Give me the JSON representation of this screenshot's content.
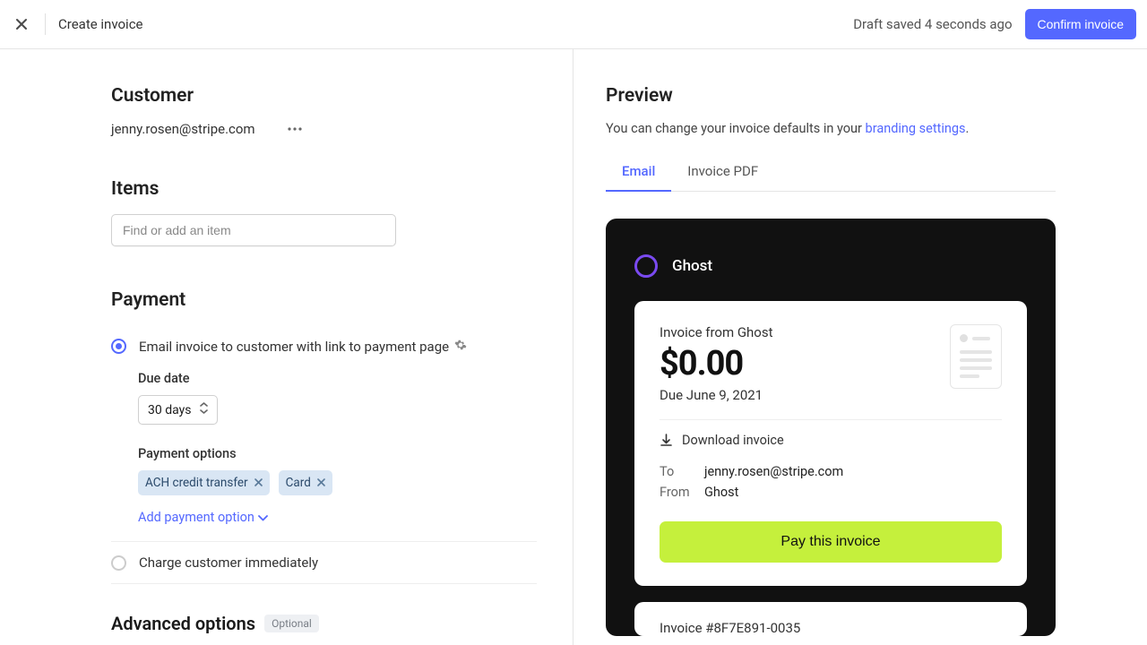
{
  "header": {
    "title": "Create invoice",
    "draft_status": "Draft saved 4 seconds ago",
    "confirm_label": "Confirm invoice"
  },
  "customer": {
    "heading": "Customer",
    "email": "jenny.rosen@stripe.com"
  },
  "items": {
    "heading": "Items",
    "placeholder": "Find or add an item"
  },
  "payment": {
    "heading": "Payment",
    "option_email": "Email invoice to customer with link to payment page",
    "option_charge": "Charge customer immediately",
    "due_date_label": "Due date",
    "due_date_value": "30 days",
    "options_label": "Payment options",
    "chips": [
      "ACH credit transfer",
      "Card"
    ],
    "add_option": "Add payment option"
  },
  "advanced": {
    "heading": "Advanced options",
    "badge": "Optional"
  },
  "preview": {
    "heading": "Preview",
    "desc_prefix": "You can change your invoice defaults in your ",
    "desc_link": "branding settings",
    "desc_suffix": ".",
    "tabs": {
      "email": "Email",
      "pdf": "Invoice PDF"
    },
    "brand": "Ghost",
    "invoice_from": "Invoice from Ghost",
    "amount": "$0.00",
    "due": "Due June 9, 2021",
    "download": "Download invoice",
    "to_label": "To",
    "to_value": "jenny.rosen@stripe.com",
    "from_label": "From",
    "from_value": "Ghost",
    "pay_label": "Pay this invoice",
    "invoice_number": "Invoice #8F7E891-0035"
  }
}
